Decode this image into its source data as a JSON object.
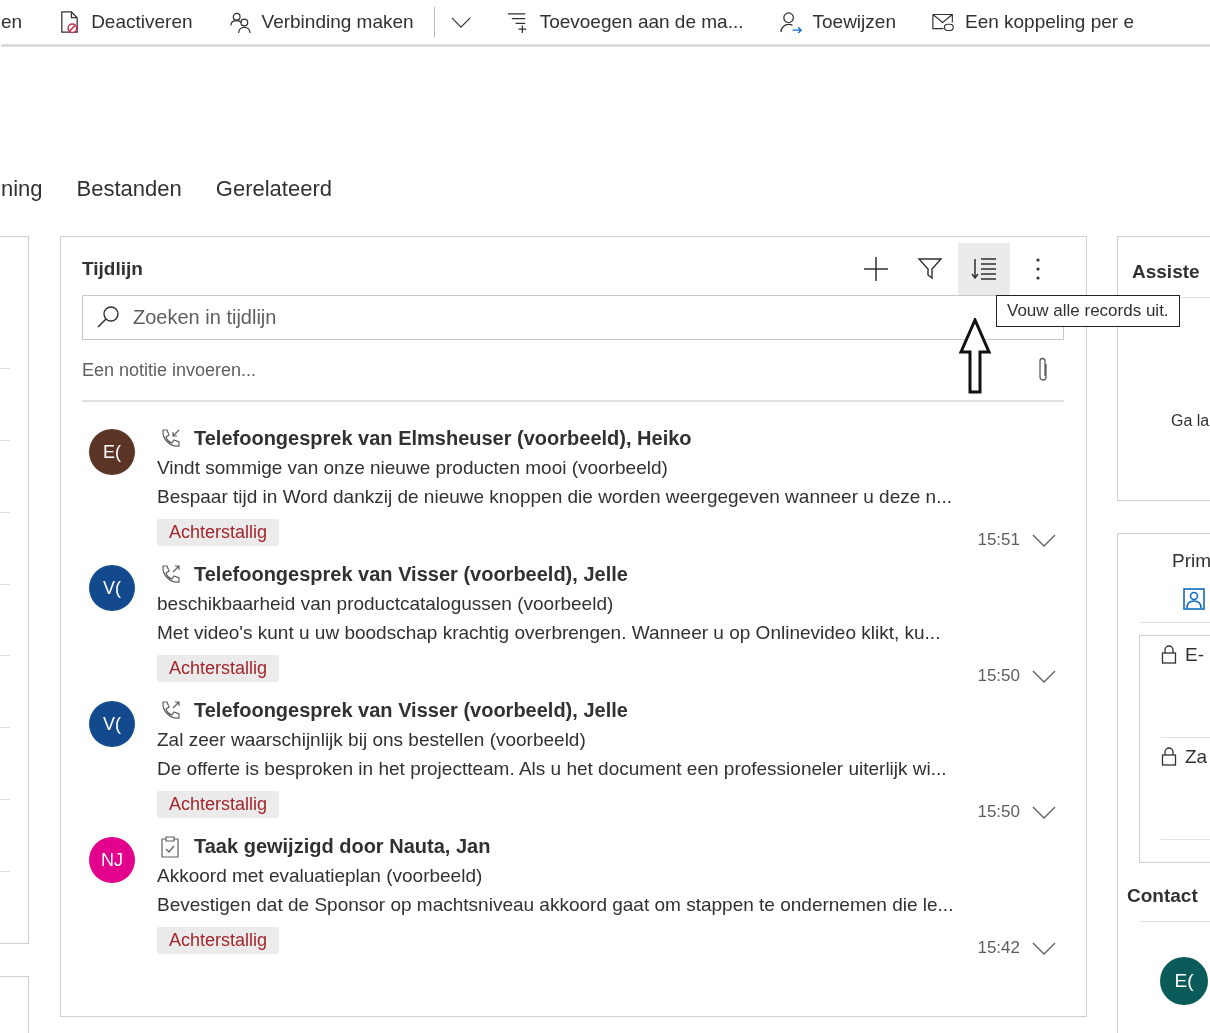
{
  "toolbar": [
    {
      "kind": "none",
      "label": "en"
    },
    {
      "kind": "deactivate",
      "label": "Deactiveren"
    },
    {
      "kind": "connect",
      "label": "Verbinding maken"
    },
    {
      "kind": "dropdown"
    },
    {
      "kind": "add-list",
      "label": "Toevoegen aan de ma..."
    },
    {
      "kind": "assign",
      "label": "Toewijzen"
    },
    {
      "kind": "mail-link",
      "label": "Een koppeling per e"
    }
  ],
  "tabs": [
    {
      "label": "ning"
    },
    {
      "label": "Bestanden"
    },
    {
      "label": "Gerelateerd"
    }
  ],
  "timeline": {
    "title": "Tijdlijn",
    "search": {
      "placeholder": "Zoeken in tijdlijn"
    },
    "tooltip": "Vouw alle records uit.",
    "note": {
      "placeholder": "Een notitie invoeren..."
    },
    "items": [
      {
        "initials": "E(",
        "color": "#5b3426",
        "kind": "call-in",
        "title": "Telefoongesprek van Elmsheuser (voorbeeld), Heiko",
        "subtitle": "Vindt sommige van onze nieuwe producten mooi (voorbeeld)",
        "body": "Bespaar tijd in Word dankzij de nieuwe knoppen die worden weergegeven wanneer u deze n...",
        "tag": "Achterstallig",
        "time": "15:51"
      },
      {
        "initials": "V(",
        "color": "#134a8e",
        "kind": "call-out",
        "title": "Telefoongesprek van Visser (voorbeeld), Jelle",
        "subtitle": "beschikbaarheid van productcatalogussen (voorbeeld)",
        "body": "Met video's kunt u uw boodschap krachtig overbrengen. Wanneer u op Onlinevideo klikt, ku...",
        "tag": "Achterstallig",
        "time": "15:50"
      },
      {
        "initials": "V(",
        "color": "#134a8e",
        "kind": "call-out",
        "title": "Telefoongesprek van Visser (voorbeeld), Jelle",
        "subtitle": "Zal zeer waarschijnlijk bij ons bestellen (voorbeeld)",
        "body": "De offerte is besproken in het projectteam. Als u het document een professioneler uiterlijk wi...",
        "tag": "Achterstallig",
        "time": "15:50"
      },
      {
        "initials": "NJ",
        "color": "#e3008c",
        "kind": "task",
        "title": "Taak gewijzigd door Nauta, Jan",
        "subtitle": "Akkoord met evaluatieplan (voorbeeld)",
        "body": "Bevestigen dat de Sponsor op machtsniveau akkoord gaat om stappen te ondernemen die le...",
        "tag": "Achterstallig",
        "time": "15:42"
      }
    ]
  },
  "right": {
    "assistant_title": "Assiste",
    "assistant_text": "Ga la",
    "primary_label": "Prim",
    "fields": [
      {
        "label": "E-"
      },
      {
        "label": "Za"
      }
    ],
    "contacts_title": "Contact",
    "contact_initials": "E("
  }
}
